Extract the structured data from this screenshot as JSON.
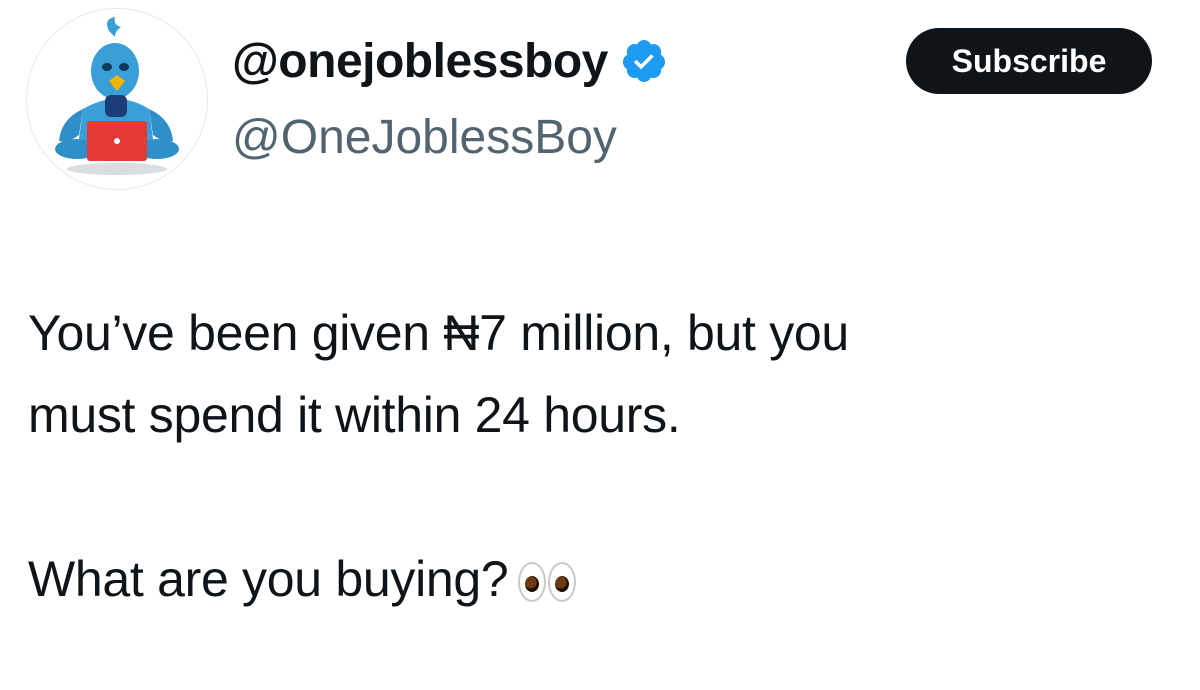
{
  "profile": {
    "display_name": "@onejoblessboy",
    "handle": "@OneJoblessBoy",
    "verified": true,
    "verified_icon": "verified-badge-icon",
    "avatar_icon": "blue-bird-laptop-avatar"
  },
  "actions": {
    "subscribe_label": "Subscribe"
  },
  "tweet": {
    "line1": "You’ve been given ₦7 million, but you",
    "line2": "must spend it within 24 hours.",
    "line3": "What are you buying?",
    "emoji": "eyes-emoji"
  },
  "colors": {
    "text_primary": "#0f1419",
    "text_secondary": "#536471",
    "verified_blue": "#1d9bf0",
    "button_bg": "#0f1419",
    "button_text": "#ffffff",
    "avatar_bird": "#3a9fd6",
    "avatar_laptop": "#e53935"
  }
}
